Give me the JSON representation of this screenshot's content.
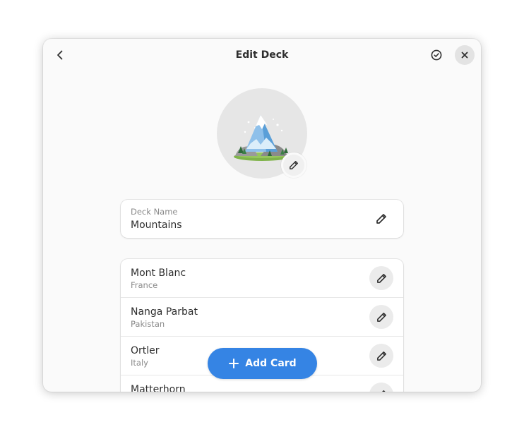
{
  "header": {
    "title": "Edit Deck"
  },
  "deck_name": {
    "label": "Deck Name",
    "value": "Mountains"
  },
  "cards": [
    {
      "title": "Mont Blanc",
      "subtitle": "France"
    },
    {
      "title": "Nanga Parbat",
      "subtitle": "Pakistan"
    },
    {
      "title": "Ortler",
      "subtitle": "Italy"
    },
    {
      "title": "Matterhorn",
      "subtitle": ""
    }
  ],
  "add_card": {
    "label": "Add Card"
  },
  "icons": {
    "back": "chevron-left-icon",
    "confirm": "check-circle-icon",
    "close": "close-icon",
    "edit": "pencil-icon",
    "add": "plus-icon"
  },
  "colors": {
    "accent": "#3584e4",
    "window_bg": "#fafafa",
    "text": "#2e2e2e",
    "subtitle": "#8a8a8a"
  }
}
